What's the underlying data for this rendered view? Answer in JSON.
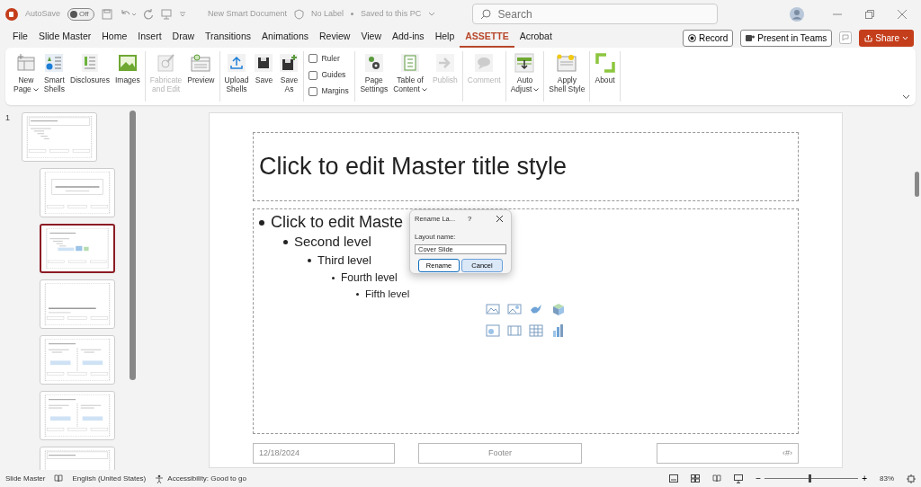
{
  "title_bar": {
    "autosave": {
      "label": "AutoSave",
      "on": false,
      "state_text": "Off"
    },
    "document_title": "New Smart Document",
    "sensitivity": "No Label",
    "save_status": "Saved to this PC",
    "search": {
      "placeholder": "Search"
    }
  },
  "menu_tabs": [
    {
      "label": "File",
      "selected": false
    },
    {
      "label": "Slide Master",
      "selected": false
    },
    {
      "label": "Home",
      "selected": false
    },
    {
      "label": "Insert",
      "selected": false
    },
    {
      "label": "Draw",
      "selected": false
    },
    {
      "label": "Transitions",
      "selected": false
    },
    {
      "label": "Animations",
      "selected": false
    },
    {
      "label": "Review",
      "selected": false
    },
    {
      "label": "View",
      "selected": false
    },
    {
      "label": "Add-ins",
      "selected": false
    },
    {
      "label": "Help",
      "selected": false
    },
    {
      "label": "ASSETTE",
      "selected": true
    },
    {
      "label": "Acrobat",
      "selected": false
    }
  ],
  "actions": {
    "record": "Record",
    "present": "Present in Teams",
    "share": "Share"
  },
  "ribbon": {
    "groups": [
      {
        "items": [
          {
            "kind": "button",
            "label": "New\nPage",
            "dropdown": true,
            "disabled": false
          },
          {
            "kind": "button",
            "label": "Smart\nShells",
            "dropdown": false,
            "disabled": false
          },
          {
            "kind": "button",
            "label": "Disclosures",
            "dropdown": false,
            "disabled": false
          },
          {
            "kind": "button",
            "label": "Images",
            "dropdown": false,
            "disabled": false
          }
        ]
      },
      {
        "items": [
          {
            "kind": "button",
            "label": "Fabricate\nand Edit",
            "dropdown": false,
            "disabled": true
          },
          {
            "kind": "button",
            "label": "Preview",
            "dropdown": false,
            "disabled": false
          }
        ]
      },
      {
        "items": [
          {
            "kind": "button",
            "label": "Upload\nShells",
            "dropdown": false,
            "disabled": false
          },
          {
            "kind": "button",
            "label": "Save",
            "dropdown": false,
            "disabled": false
          },
          {
            "kind": "button",
            "label": "Save\nAs",
            "dropdown": false,
            "disabled": false
          }
        ]
      },
      {
        "items": [
          {
            "kind": "checkbox",
            "label": "Ruler",
            "checked": false
          },
          {
            "kind": "checkbox",
            "label": "Guides",
            "checked": false
          },
          {
            "kind": "checkbox",
            "label": "Margins",
            "checked": false
          }
        ]
      },
      {
        "items": [
          {
            "kind": "button",
            "label": "Page\nSettings",
            "dropdown": false,
            "disabled": false
          },
          {
            "kind": "button",
            "label": "Table of\nContent",
            "dropdown": true,
            "disabled": false
          },
          {
            "kind": "button",
            "label": "Publish",
            "dropdown": false,
            "disabled": true
          }
        ]
      },
      {
        "items": [
          {
            "kind": "button",
            "label": "Comment",
            "dropdown": false,
            "disabled": true
          }
        ]
      },
      {
        "items": [
          {
            "kind": "button",
            "label": "Auto\nAdjust",
            "dropdown": true,
            "disabled": false
          }
        ]
      },
      {
        "items": [
          {
            "kind": "button",
            "label": "Apply\nShell Style",
            "dropdown": false,
            "disabled": false
          }
        ]
      },
      {
        "items": [
          {
            "kind": "button",
            "label": "About",
            "dropdown": false,
            "disabled": false
          }
        ]
      }
    ]
  },
  "thumbnails": [
    {
      "number": "1",
      "kind": "master",
      "selected": false
    },
    {
      "kind": "title",
      "selected": false
    },
    {
      "kind": "content",
      "selected": true
    },
    {
      "kind": "section",
      "selected": false
    },
    {
      "kind": "two",
      "selected": false
    },
    {
      "kind": "compare",
      "selected": false
    },
    {
      "kind": "title_only",
      "selected": false
    }
  ],
  "slide": {
    "title": "Click to edit Master title style",
    "levels": [
      {
        "text": "Click to edit Maste",
        "children": [
          {
            "text": "Second level",
            "children": [
              {
                "text": "Third level",
                "children": [
                  {
                    "text": "Fourth level",
                    "children": [
                      {
                        "text": "Fifth level"
                      }
                    ]
                  }
                ]
              }
            ]
          }
        ]
      }
    ],
    "date": "12/18/2024",
    "footer": "Footer",
    "page_number": "‹#›"
  },
  "dialog": {
    "title": "Rename La...",
    "help": "?",
    "field_label": "Layout name:",
    "value": "Cover Slide",
    "buttons": [
      {
        "label": "Rename",
        "selected": true
      },
      {
        "label": "Cancel",
        "selected": false
      }
    ]
  },
  "status_bar": {
    "view": "Slide Master",
    "language": "English (United States)",
    "accessibility": "Accessibility: Good to go",
    "zoom_out": "−",
    "zoom_in": "+",
    "zoom": {
      "level": 0.48
    },
    "zoom_text": "83%"
  }
}
